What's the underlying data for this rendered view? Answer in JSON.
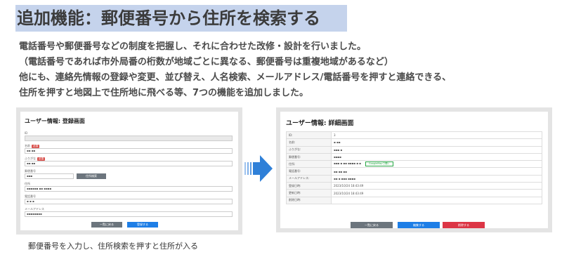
{
  "headline": "追加機能：郵便番号から住所を検索する",
  "description": [
    "電話番号や郵便番号などの制度を把握し、それに合わせた改修・設計を行いました。",
    "（電話番号であれば市外局番の桁数が地域ごとに異なる、郵便番号は重複地域があるなど）",
    "他にも、連絡先情報の登録や変更、並び替え、人名検索、メールアドレス/電話番号を押すと連絡できる、",
    "住所を押すと地図上で住所地に飛べる等、7つの機能を追加しました。"
  ],
  "register_screen": {
    "title": "ユーザー情報: 登録画面",
    "labels": {
      "id": "ID",
      "name": "名前",
      "kana": "ふりがな",
      "zip": "郵便番号",
      "address": "住所",
      "phone": "電話番号",
      "email": "メールアドレス"
    },
    "required_badge": "必須",
    "search_button": "住所検索",
    "back_button": "一覧に戻る",
    "submit_button": "登録する"
  },
  "detail_screen": {
    "title": "ユーザー情報: 詳細画面",
    "rows": [
      {
        "key": "ID:",
        "value": "3"
      },
      {
        "key": "名前:",
        "value": ""
      },
      {
        "key": "ふりがな:",
        "value": ""
      },
      {
        "key": "郵便番号:",
        "value": ""
      },
      {
        "key": "住所:",
        "value": ""
      },
      {
        "key": "電話番号:",
        "value": ""
      },
      {
        "key": "メールアドレス:",
        "value": ""
      },
      {
        "key": "登録日時:",
        "value": "2023/10/24 18:43:49"
      },
      {
        "key": "更新日時:",
        "value": "2023/10/24 18:43:49"
      },
      {
        "key": "削除日時:",
        "value": ""
      }
    ],
    "map_button": "GoogleMapで開く",
    "back_button": "一覧に戻る",
    "edit_button": "編集する",
    "delete_button": "削除する"
  },
  "caption": "郵便番号を入力し、住所検索を押すと住所が入る",
  "colors": {
    "headline_bg": "#c5d3ec",
    "arrow": "#2f80d8"
  }
}
